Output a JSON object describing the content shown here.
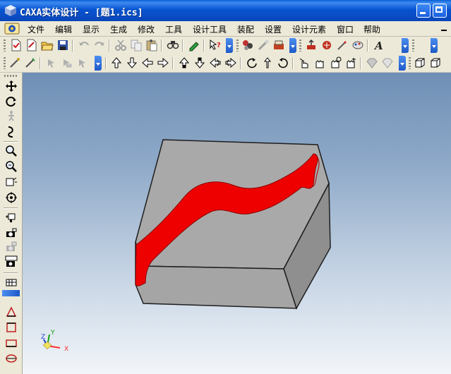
{
  "window": {
    "title": "CAXA实体设计 - [题1.ics]"
  },
  "menubar": {
    "items": [
      "文件",
      "编辑",
      "显示",
      "生成",
      "修改",
      "工具",
      "设计工具",
      "装配",
      "设置",
      "设计元素",
      "窗口",
      "帮助"
    ]
  },
  "toolbar_top": {
    "icons": [
      "new-document-icon",
      "new-drawing-icon",
      "open-folder-icon",
      "save-icon",
      "undo-icon",
      "redo-icon",
      "cut-icon",
      "copy-icon",
      "paste-icon",
      "find-icon",
      "clear-icon",
      "whats-this-help-icon",
      "design-tree-icon",
      "design-element-icon",
      "render-icon",
      "shading-icon",
      "texture-icon",
      "wizard-icon",
      "text-icon"
    ]
  },
  "toolbar_second": {
    "icons": [
      "pick-icon",
      "edit-icon",
      "smart-select-icon",
      "move-icon",
      "rotate-select-icon",
      "arrow-up-icon",
      "arrow-down-icon",
      "arrow-left-icon",
      "arrow-right-icon",
      "view-up-icon",
      "view-down-icon",
      "pan-left-icon",
      "pan-right-icon",
      "rotate-left-icon",
      "rotate-up-icon",
      "rotate-right-icon",
      "hand-pointer-icon",
      "hand-grab-icon",
      "hand-spin-icon",
      "hand-zoom-icon",
      "gem-icon",
      "gem-outline-icon",
      "box-view-icon",
      "box-view-alt-icon"
    ]
  },
  "left_toolbar": {
    "icons": [
      "move-cross-icon",
      "orbit-icon",
      "walk-icon",
      "spin-icon",
      "zoom-icon",
      "zoom-window-icon",
      "zoom-fit-icon",
      "target-icon",
      "camera-icon",
      "camera-alt-icon",
      "camera-setup-icon",
      "camera-view-icon",
      "grid-icon",
      "triangle-icon",
      "rectangle-icon",
      "square-icon",
      "ellipse-icon"
    ]
  },
  "viewport": {
    "triad": {
      "x_label": "X",
      "y_label": "Y",
      "z_label": "Z"
    },
    "colors": {
      "block_top": "#a9a9a9",
      "block_side": "#8d8d8d",
      "groove": "#ee0000",
      "axis_x": "#ff3030",
      "axis_y": "#10a010",
      "axis_z": "#2040d0"
    }
  }
}
